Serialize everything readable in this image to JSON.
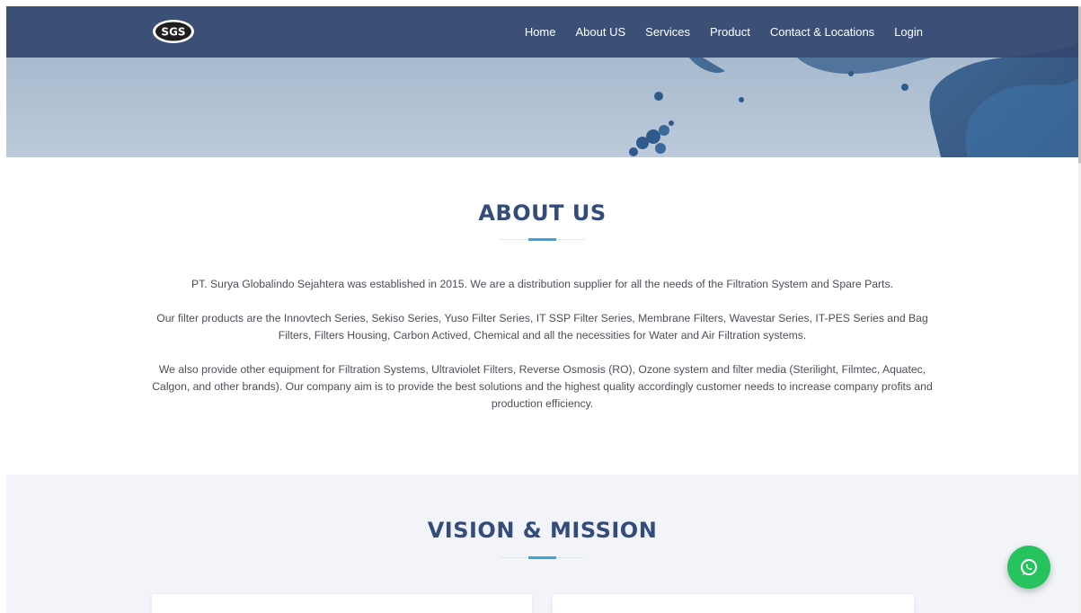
{
  "brand": {
    "logo_text": "SGS"
  },
  "nav": {
    "items": [
      "Home",
      "About US",
      "Services",
      "Product",
      "Contact & Locations",
      "Login"
    ]
  },
  "about": {
    "title": "ABOUT US",
    "paragraphs": [
      "PT. Surya Globalindo Sejahtera was established in 2015. We are a distribution supplier for all the needs of the Filtration System and Spare Parts.",
      "Our filter products are the Innovtech Series, Sekiso Series, Yuso Filter Series, IT SSP Filter Series, Membrane Filters, Wavestar Series, IT-PES Series and Bag Filters, Filters Housing, Carbon Actived, Chemical and all the necessities for Water and Air Filtration systems.",
      "We also provide other equipment for Filtration Systems, Ultraviolet Filters, Reverse Osmosis (RO), Ozone system and filter media (Sterilight, Filmtec, Aquatec, Calgon, and other brands). Our company aim is to provide the best solutions and the highest quality accordingly customer needs to increase company profits and production efficiency."
    ]
  },
  "vision": {
    "title": "VISION & MISSION"
  },
  "colors": {
    "navbar": "#344870",
    "heading": "#344c7c",
    "accent": "#3aa4df",
    "whatsapp": "#25c25e",
    "section_bg": "#f2f4f9"
  },
  "icons": {
    "floating_button": "whatsapp-icon"
  }
}
